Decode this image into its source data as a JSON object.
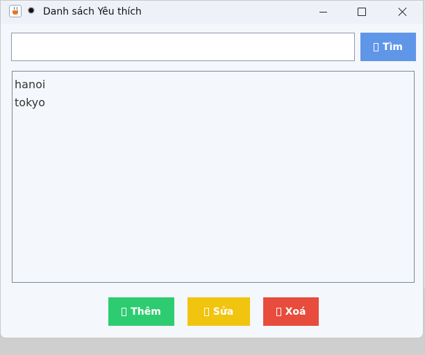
{
  "window": {
    "title": "Danh sách Yêu thích",
    "title_glyph": "✹"
  },
  "search": {
    "value": "",
    "placeholder": "",
    "button_label": "Tìm"
  },
  "list": {
    "items": [
      "hanoi",
      "tokyo"
    ]
  },
  "actions": {
    "add_label": "Thêm",
    "edit_label": "Sửa",
    "delete_label": "Xoá"
  },
  "colors": {
    "search_button": "#6096e8",
    "add_button": "#2ecc71",
    "edit_button": "#f1c40f",
    "delete_button": "#e74c3c"
  },
  "icons": {
    "app": "java-app-icon",
    "title_decoration": "sun-icon",
    "button_glyph": "missing-glyph-box"
  }
}
